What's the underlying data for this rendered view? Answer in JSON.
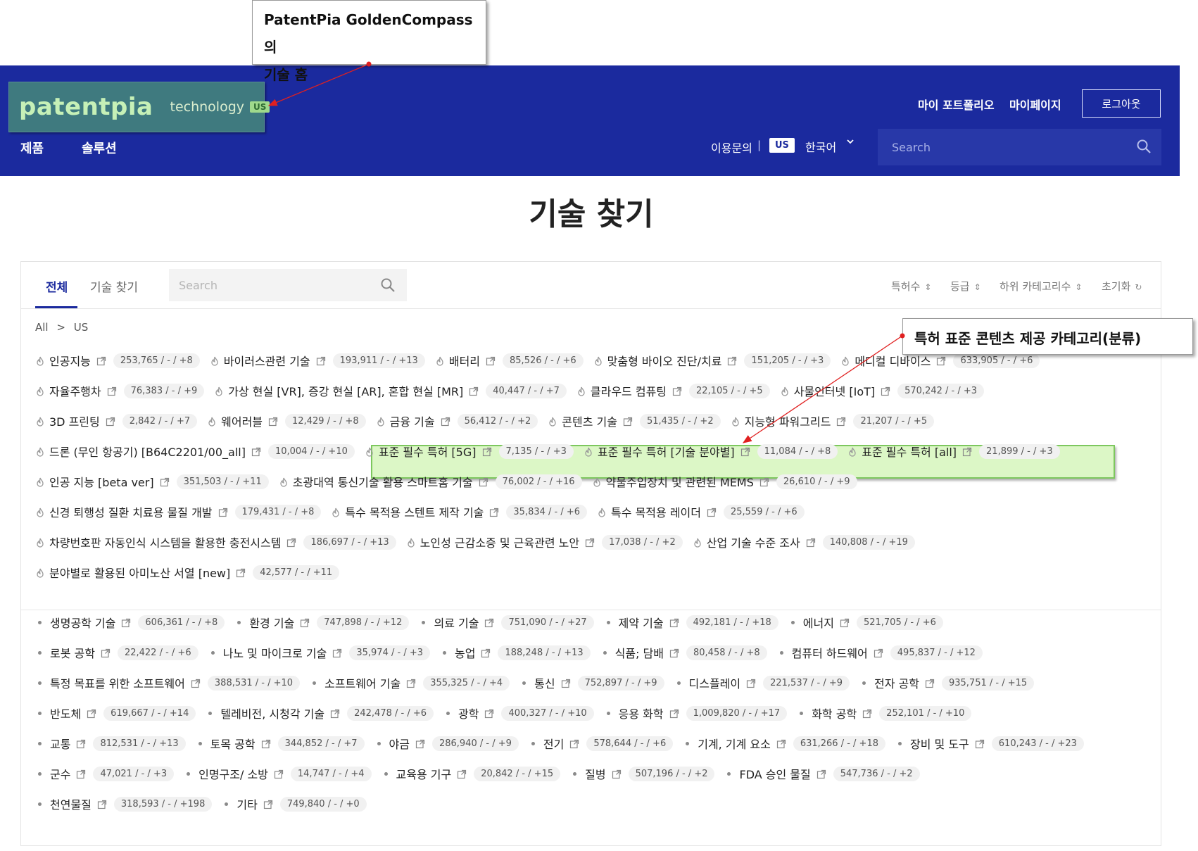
{
  "annotations": {
    "top_line1": "PatentPia GoldenCompass의",
    "top_line2": "기술 홈",
    "right": "특허 표준 콘텐츠 제공 카테고리(분류)"
  },
  "header": {
    "logo": "patentpia",
    "logo_sub": "technology",
    "logo_badge": "US",
    "nav": [
      "제품",
      "솔루션"
    ],
    "my_portfolio": "마이 포트폴리오",
    "my_page": "마이페이지",
    "logout": "로그아웃",
    "contact": "이용문의",
    "separator": "|",
    "region_badge": "US",
    "language": "한국어",
    "search_placeholder": "Search"
  },
  "page_title": "기술 찾기",
  "panel": {
    "tabs": [
      "전체",
      "기술 찾기"
    ],
    "search_placeholder": "Search",
    "sorts": [
      "특허수",
      "등급",
      "하위 카테고리수",
      "초기화"
    ],
    "breadcrumb": [
      "All",
      ">",
      "US"
    ]
  },
  "featured_rows": [
    [
      {
        "name": "인공지능",
        "stat": "253,765 / - / +8"
      },
      {
        "name": "바이러스관련 기술",
        "stat": "193,911 / - / +13"
      },
      {
        "name": "배터리",
        "stat": "85,526 / - / +6"
      },
      {
        "name": "맞춤형 바이오 진단/치료",
        "stat": "151,205 / - / +3"
      },
      {
        "name": "메디컬 디바이스",
        "stat": "633,905 / - / +6"
      }
    ],
    [
      {
        "name": "자율주행차",
        "stat": "76,383 / - / +9"
      },
      {
        "name": "가상 현실 [VR], 증강 현실 [AR], 혼합 현실 [MR]",
        "stat": "40,447 / - / +7"
      },
      {
        "name": "클라우드 컴퓨팅",
        "stat": "22,105 / - / +5"
      },
      {
        "name": "사물인터넷 [IoT]",
        "stat": "570,242 / - / +3"
      }
    ],
    [
      {
        "name": "3D 프린팅",
        "stat": "2,842 / - / +7"
      },
      {
        "name": "웨어러블",
        "stat": "12,429 / - / +8"
      },
      {
        "name": "금융 기술",
        "stat": "56,412 / - / +2"
      },
      {
        "name": "콘텐츠 기술",
        "stat": "51,435 / - / +2"
      },
      {
        "name": "지능형 파워그리드",
        "stat": "21,207 / - / +5"
      }
    ],
    [
      {
        "name": "드론 (무인 항공기) [B64C2201/00_all]",
        "stat": "10,004 / - / +10"
      },
      {
        "name": "표준 필수 특허 [5G]",
        "stat": "7,135 / - / +3"
      },
      {
        "name": "표준 필수 특허 [기술 분야별]",
        "stat": "11,084 / - / +8"
      },
      {
        "name": "표준 필수 특허 [all]",
        "stat": "21,899 / - / +3"
      }
    ],
    [
      {
        "name": "인공 지능 [beta ver]",
        "stat": "351,503 / - / +11"
      },
      {
        "name": "초광대역 통신기술 활용 스마트홈 기술",
        "stat": "76,002 / - / +16"
      },
      {
        "name": "약물주입장치 및 관련된 MEMS",
        "stat": "26,610 / - / +9"
      }
    ],
    [
      {
        "name": "신경 퇴행성 질환 치료용 물질 개발",
        "stat": "179,431 / - / +8"
      },
      {
        "name": "특수 목적용 스텐트 제작 기술",
        "stat": "35,834 / - / +6"
      },
      {
        "name": "특수 목적용 레이더",
        "stat": "25,559 / - / +6"
      }
    ],
    [
      {
        "name": "차량번호판 자동인식 시스템을 활용한 충전시스템",
        "stat": "186,697 / - / +13"
      },
      {
        "name": "노인성 근감소증 및 근육관련 노안",
        "stat": "17,038 / - / +2"
      },
      {
        "name": "산업 기술 수준 조사",
        "stat": "140,808 / - / +19"
      }
    ],
    [
      {
        "name": "분야별로 활용된 아미노산 서열 [new]",
        "stat": "42,577 / - / +11"
      }
    ]
  ],
  "category_rows": [
    [
      {
        "name": "생명공학 기술",
        "stat": "606,361 / - / +8"
      },
      {
        "name": "환경 기술",
        "stat": "747,898 / - / +12"
      },
      {
        "name": "의료 기술",
        "stat": "751,090 / - / +27"
      },
      {
        "name": "제약 기술",
        "stat": "492,181 / - / +18"
      },
      {
        "name": "에너지",
        "stat": "521,705 / - / +6"
      }
    ],
    [
      {
        "name": "로봇 공학",
        "stat": "22,422 / - / +6"
      },
      {
        "name": "나노 및 마이크로 기술",
        "stat": "35,974 / - / +3"
      },
      {
        "name": "농업",
        "stat": "188,248 / - / +13"
      },
      {
        "name": "식품; 담배",
        "stat": "80,458 / - / +8"
      },
      {
        "name": "컴퓨터 하드웨어",
        "stat": "495,837 / - / +12"
      }
    ],
    [
      {
        "name": "특정 목표를 위한 소프트웨어",
        "stat": "388,531 / - / +10"
      },
      {
        "name": "소프트웨어 기술",
        "stat": "355,325 / - / +4"
      },
      {
        "name": "통신",
        "stat": "752,897 / - / +9"
      },
      {
        "name": "디스플레이",
        "stat": "221,537 / - / +9"
      },
      {
        "name": "전자 공학",
        "stat": "935,751 / - / +15"
      }
    ],
    [
      {
        "name": "반도체",
        "stat": "619,667 / - / +14"
      },
      {
        "name": "텔레비전, 시청각 기술",
        "stat": "242,478 / - / +6"
      },
      {
        "name": "광학",
        "stat": "400,327 / - / +10"
      },
      {
        "name": "응용 화학",
        "stat": "1,009,820 / - / +17"
      },
      {
        "name": "화학 공학",
        "stat": "252,101 / - / +10"
      }
    ],
    [
      {
        "name": "교통",
        "stat": "812,531 / - / +13"
      },
      {
        "name": "토목 공학",
        "stat": "344,852 / - / +7"
      },
      {
        "name": "야금",
        "stat": "286,940 / - / +9"
      },
      {
        "name": "전기",
        "stat": "578,644 / - / +6"
      },
      {
        "name": "기계, 기계 요소",
        "stat": "631,266 / - / +18"
      },
      {
        "name": "장비 및 도구",
        "stat": "610,243 / - / +23"
      }
    ],
    [
      {
        "name": "군수",
        "stat": "47,021 / - / +3"
      },
      {
        "name": "인명구조/ 소방",
        "stat": "14,747 / - / +4"
      },
      {
        "name": "교육용 기구",
        "stat": "20,842 / - / +15"
      },
      {
        "name": "질병",
        "stat": "507,196 / - / +2"
      },
      {
        "name": "FDA 승인 물질",
        "stat": "547,736 / - / +2"
      }
    ],
    [
      {
        "name": "천연물질",
        "stat": "318,593 / - / +198"
      },
      {
        "name": "기타",
        "stat": "749,840 / - / +0"
      }
    ]
  ],
  "colors": {
    "header_bg": "#1b2a9e",
    "logo_bg": "#3f7a7f",
    "highlight_bg": "#dcf7c6",
    "highlight_border": "#7dc75e",
    "arrow": "#e02020"
  }
}
